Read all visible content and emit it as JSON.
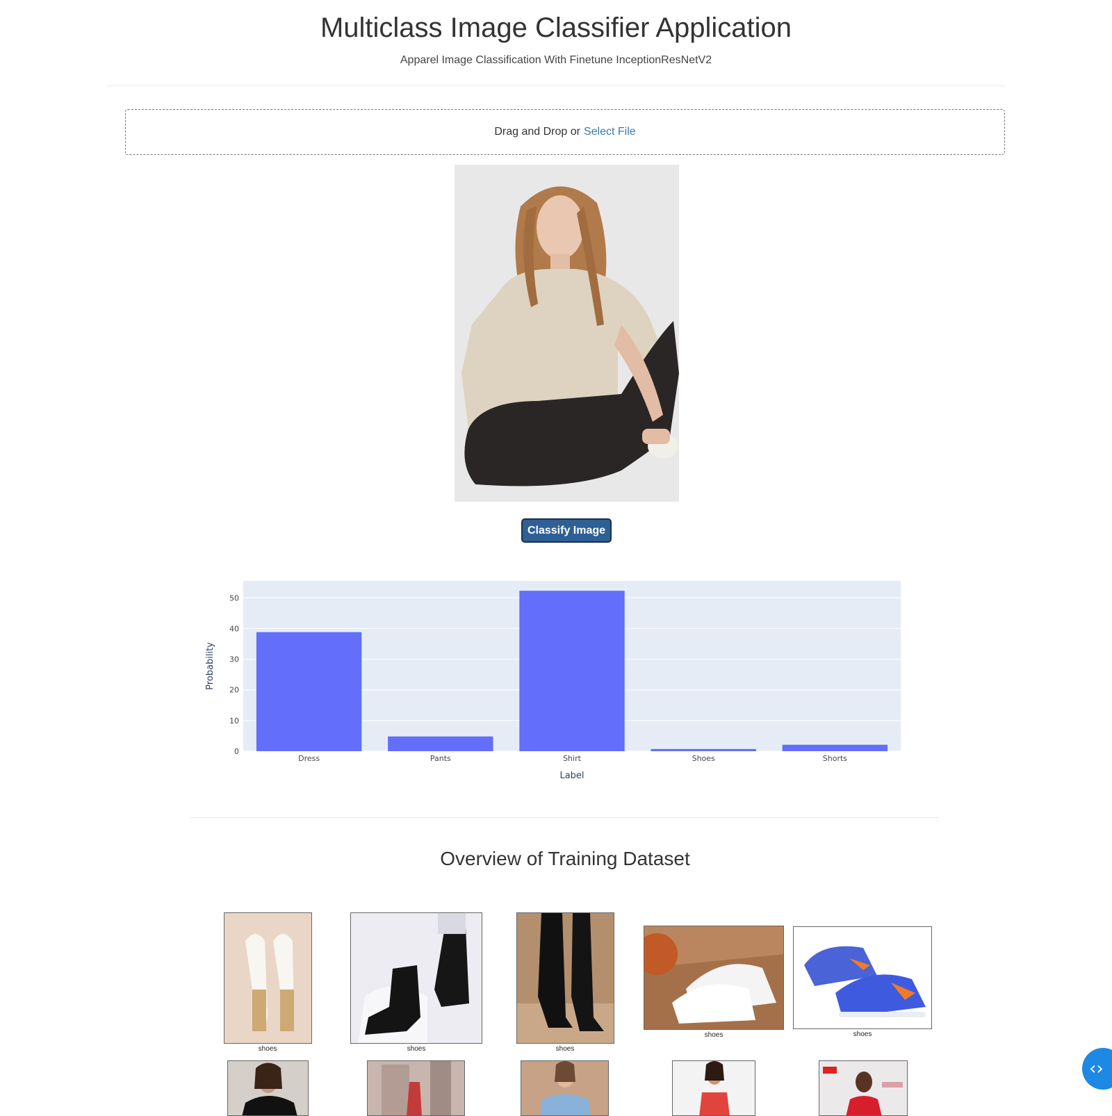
{
  "header": {
    "title": "Multiclass Image Classifier Application",
    "subtitle": "Apparel Image Classification With Finetune InceptionResNetV2"
  },
  "upload": {
    "prompt": "Drag and Drop or",
    "link_label": "Select File"
  },
  "classify_button_label": "Classify Image",
  "chart_data": {
    "type": "bar",
    "categories": [
      "Dress",
      "Pants",
      "Shirt",
      "Shoes",
      "Shorts"
    ],
    "values": [
      38.8,
      4.8,
      52.3,
      0.7,
      2.1
    ],
    "xlabel": "Label",
    "ylabel": "Probability",
    "ylim": [
      0,
      55.5
    ],
    "yticks": [
      0,
      10,
      20,
      30,
      40,
      50
    ],
    "grid": true,
    "bar_color": "#636efa",
    "plot_bg": "#e5ecf6"
  },
  "dataset_section": {
    "title": "Overview of Training Dataset",
    "row1_captions": [
      "shoes",
      "shoes",
      "shoes",
      "shoes",
      "shoes"
    ]
  },
  "fab_icon": "code-toggle-icon",
  "colors": {
    "link": "#337ab7",
    "button_bg": "#2e6096",
    "fab": "#1e88e5"
  }
}
